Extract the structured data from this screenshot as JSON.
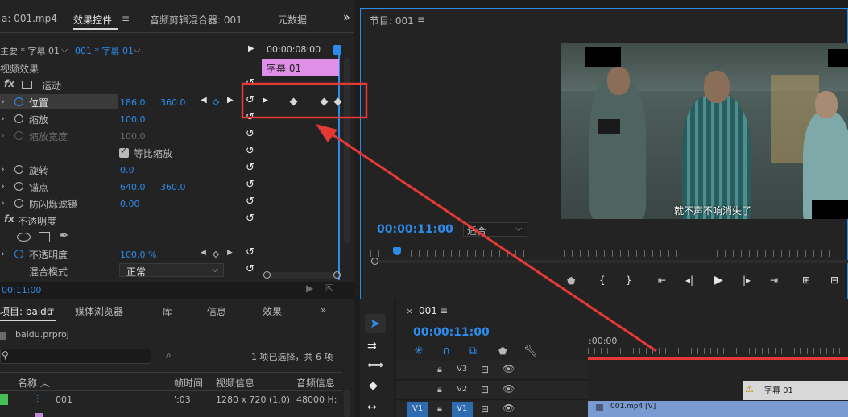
{
  "effects": {
    "tabs": {
      "source": "a: 001.mp4",
      "effect_controls": "效果控件",
      "audio_mixer": "音频剪辑混合器: 001",
      "metadata": "元数据"
    },
    "source_label": "主要 * 字幕 01",
    "clip_label": "001 * 字幕 01",
    "timecode_top": "00:00:08:00",
    "clip_bar_label": "字幕 01",
    "video_effects": "视频效果",
    "motion": "运动",
    "position": {
      "label": "位置",
      "x": "186.0",
      "y": "360.0"
    },
    "scale": {
      "label": "缩放",
      "value": "100.0"
    },
    "scale_width": {
      "label": "缩放宽度",
      "value": "100.0"
    },
    "uniform_scale": "等比缩放",
    "rotation": {
      "label": "旋转",
      "value": "0.0"
    },
    "anchor": {
      "label": "锚点",
      "x": "640.0",
      "y": "360.0"
    },
    "anti_flicker": {
      "label": "防闪烁滤镜",
      "value": "0.00"
    },
    "opacity_section": "不透明度",
    "opacity": {
      "label": "不透明度",
      "value": "100.0 %"
    },
    "blend": {
      "label": "混合模式",
      "value": "正常"
    },
    "timecode_bottom": "00:11:00"
  },
  "program": {
    "title": "节目: 001",
    "subtitle": "就不声不响消失了",
    "timecode": "00:00:11:00",
    "fit": "适合"
  },
  "project": {
    "tabs": {
      "project": "项目: baidu",
      "media_browser": "媒体浏览器",
      "library": "库",
      "info": "信息",
      "effects": "效果"
    },
    "file": "baidu.prproj",
    "selection": "1 项已选择，共 6 项",
    "columns": {
      "name": "名称",
      "time": "帧时间",
      "video": "视频信息",
      "audio": "音频信息"
    },
    "rows": [
      {
        "name": "001",
        "time": "':03",
        "video": "1280 x 720 (1.0)",
        "audio": "48000 H:"
      }
    ]
  },
  "timeline": {
    "tab": "001",
    "timecode": "00:00:11:00",
    "ruler": ":00:00",
    "tracks": [
      "V3",
      "V2",
      "V1"
    ],
    "source_track": "V1",
    "clip_title": "字幕 01",
    "clip_video": "001.mp4 [V]"
  },
  "colors": {
    "accent": "#2d8ceb",
    "clip_pink": "#e08fe8",
    "annotation_red": "#e53935",
    "clip_blue": "#7a9bd1"
  }
}
